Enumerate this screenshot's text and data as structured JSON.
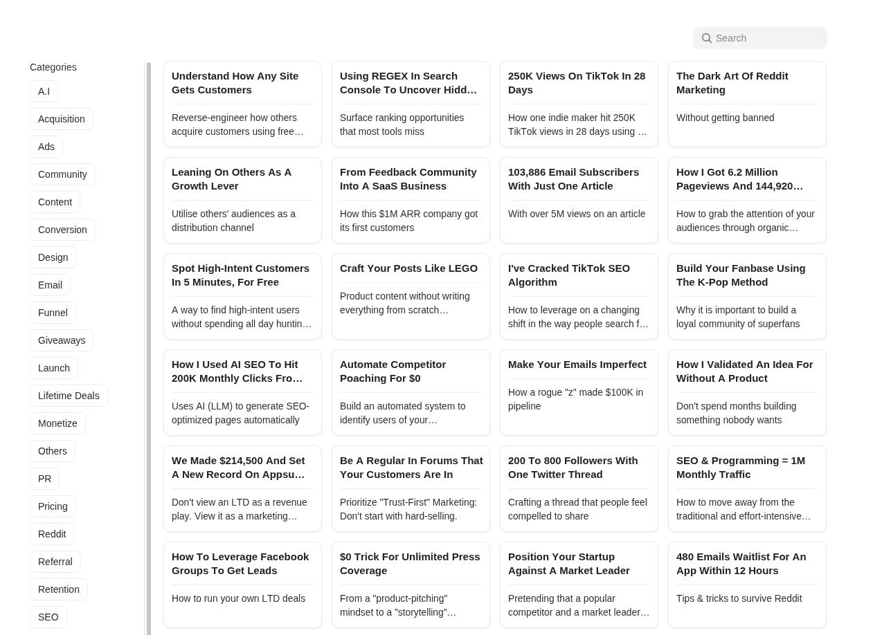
{
  "search": {
    "placeholder": "Search"
  },
  "sidebar": {
    "heading": "Categories",
    "categories": [
      "A.I",
      "Acquisition",
      "Ads",
      "Community",
      "Content",
      "Conversion",
      "Design",
      "Email",
      "Funnel",
      "Giveaways",
      "Launch",
      "Lifetime Deals",
      "Monetize",
      "Others",
      "PR",
      "Pricing",
      "Reddit",
      "Referral",
      "Retention",
      "SEO"
    ]
  },
  "cards": [
    {
      "title": "Understand How Any Site Gets Customers",
      "description": "Reverse-engineer how others acquire customers using free…"
    },
    {
      "title": "Using REGEX In Search Console To Uncover Hidd…",
      "description": "Surface ranking opportunities that most tools miss"
    },
    {
      "title": "250K Views On TikTok In 28 Days",
      "description": "How one indie maker hit 250K TikTok views in 28 days using …"
    },
    {
      "title": "The Dark Art Of Reddit Marketing",
      "description": "Without getting banned"
    },
    {
      "title": "Leaning On Others As A Growth Lever",
      "description": "Utilise others' audiences as a distribution channel"
    },
    {
      "title": "From Feedback Community Into A SaaS Business",
      "description": "How this $1M ARR company got its first customers"
    },
    {
      "title": "103,886 Email Subscribers With Just One Article",
      "description": "With over 5M views on an article"
    },
    {
      "title": "How I Got 6.2 Million Pageviews And 144,920…",
      "description": "How to grab the attention of your audiences through organic…"
    },
    {
      "title": "Spot High-Intent Customers In 5 Minutes, For Free",
      "description": "A way to find high-intent users without spending all day huntin…"
    },
    {
      "title": "Craft Your Posts Like LEGO",
      "description": "Product content without writing everything from scratch…"
    },
    {
      "title": "I've Cracked TikTok SEO Algorithm",
      "description": "How to leverage on a changing shift in the way people search f…"
    },
    {
      "title": "Build Your Fanbase Using The K-Pop Method",
      "description": "Why it is important to build a loyal community of superfans"
    },
    {
      "title": "How I Used AI SEO To Hit 200K Monthly Clicks Fro…",
      "description": "Uses AI (LLM) to generate SEO-optimized pages automatically"
    },
    {
      "title": "Automate Competitor Poaching For $0",
      "description": "Build an automated system to identify users of your…"
    },
    {
      "title": "Make Your Emails Imperfect",
      "description": "How a rogue \"z\" made $100K in pipeline"
    },
    {
      "title": "How I Validated An Idea For Without A Product",
      "description": "Don't spend months building something nobody wants"
    },
    {
      "title": "We Made $214,500 And Set A New Record On Appsu…",
      "description": "Don't view an LTD as a revenue play. View it as a marketing…"
    },
    {
      "title": "Be A Regular In Forums That Your Customers Are In",
      "description": "Prioritize \"Trust-First\" Marketing: Don't start with hard-selling."
    },
    {
      "title": "200 To 800 Followers With One Twitter Thread",
      "description": "Crafting a thread that people feel compelled to share"
    },
    {
      "title": "SEO & Programming = 1M Monthly Traffic",
      "description": "How to move away from the traditional and effort-intensive…"
    },
    {
      "title": "How To Leverage Facebook Groups To Get Leads",
      "description": "How to run your own LTD deals"
    },
    {
      "title": "$0 Trick For Unlimited Press Coverage",
      "description": "From a \"product-pitching\" mindset to a \"storytelling\"…"
    },
    {
      "title": "Position Your Startup Against A Market Leader",
      "description": "Pretending that a popular competitor and a market leader…"
    },
    {
      "title": "480 Emails Waitlist For An App Within 12 Hours",
      "description": "Tips & tricks to survive Reddit"
    }
  ]
}
